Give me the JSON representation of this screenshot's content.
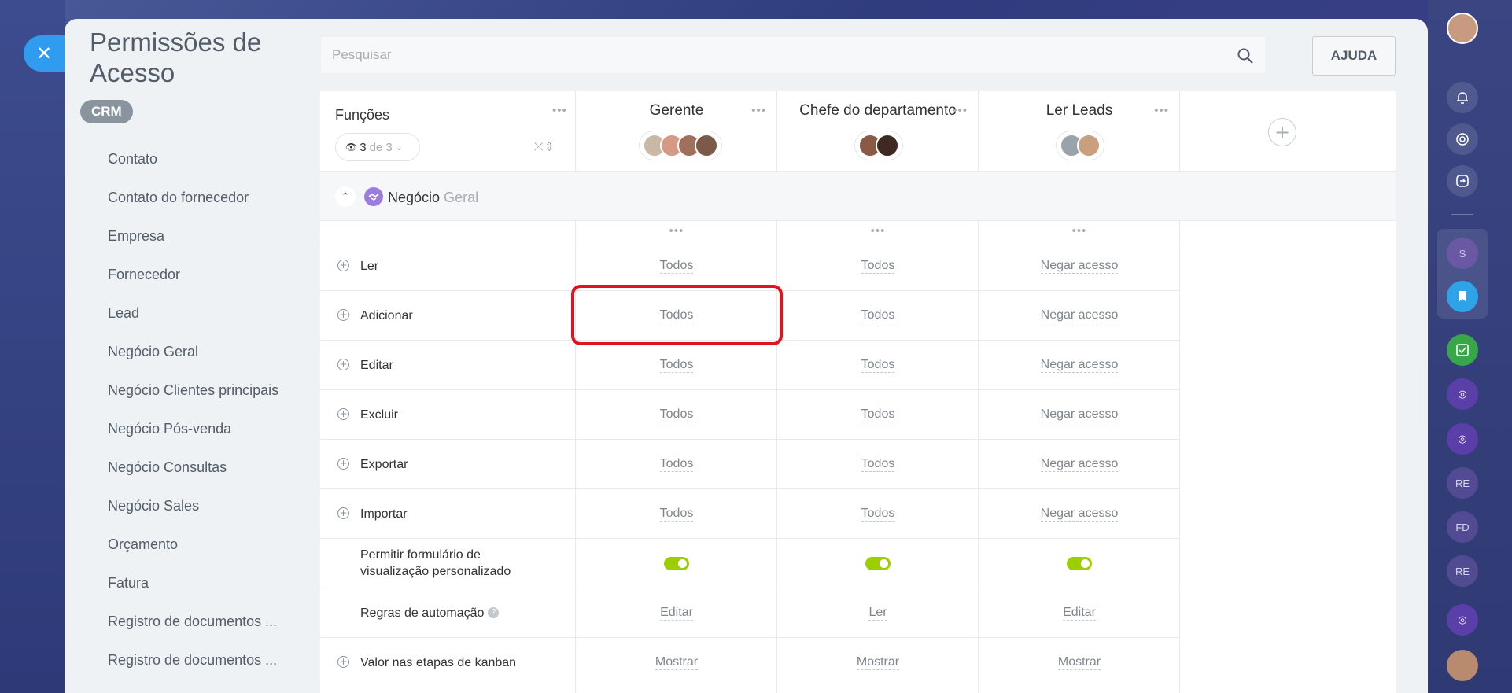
{
  "page": {
    "title": "Permissões de Acesso",
    "close_icon": "close-icon"
  },
  "badge": "CRM",
  "menu": [
    "Contato",
    "Contato do fornecedor",
    "Empresa",
    "Fornecedor",
    "Lead",
    "Negócio Geral",
    "Negócio Clientes principais",
    "Negócio Pós-venda",
    "Negócio Consultas",
    "Negócio Sales",
    "Orçamento",
    "Fatura",
    "Registro de documentos ...",
    "Registro de documentos ..."
  ],
  "search": {
    "placeholder": "Pesquisar"
  },
  "help_label": "AJUDA",
  "table": {
    "functions_label": "Funções",
    "counter": {
      "shown": "3",
      "of": "de 3"
    },
    "roles": [
      "Gerente",
      "Chefe do departamento",
      "Ler Leads"
    ],
    "section": {
      "title": "Negócio",
      "subtitle": "Geral"
    },
    "rows": [
      {
        "label": "Ler",
        "values": [
          "Todos",
          "Todos",
          "Negar acesso"
        ]
      },
      {
        "label": "Adicionar",
        "values": [
          "Todos",
          "Todos",
          "Negar acesso"
        ]
      },
      {
        "label": "Editar",
        "values": [
          "Todos",
          "Todos",
          "Negar acesso"
        ]
      },
      {
        "label": "Excluir",
        "values": [
          "Todos",
          "Todos",
          "Negar acesso"
        ]
      },
      {
        "label": "Exportar",
        "values": [
          "Todos",
          "Todos",
          "Negar acesso"
        ]
      },
      {
        "label": "Importar",
        "values": [
          "Todos",
          "Todos",
          "Negar acesso"
        ]
      },
      {
        "label": "Permitir formulário de visualização personalizado",
        "values": [
          true,
          true,
          true
        ]
      },
      {
        "label": "Regras de automação",
        "values": [
          "Editar",
          "Ler",
          "Editar"
        ]
      },
      {
        "label": "Valor nas etapas de kanban",
        "values": [
          "Mostrar",
          "Mostrar",
          "Mostrar"
        ]
      }
    ]
  },
  "colors": {
    "accent": "#2f9cf0",
    "toggle_on": "#9dcf00",
    "highlight": "#e0141e"
  },
  "right_rail": {
    "badges": [
      "S",
      "RE",
      "FD",
      "RE"
    ]
  }
}
